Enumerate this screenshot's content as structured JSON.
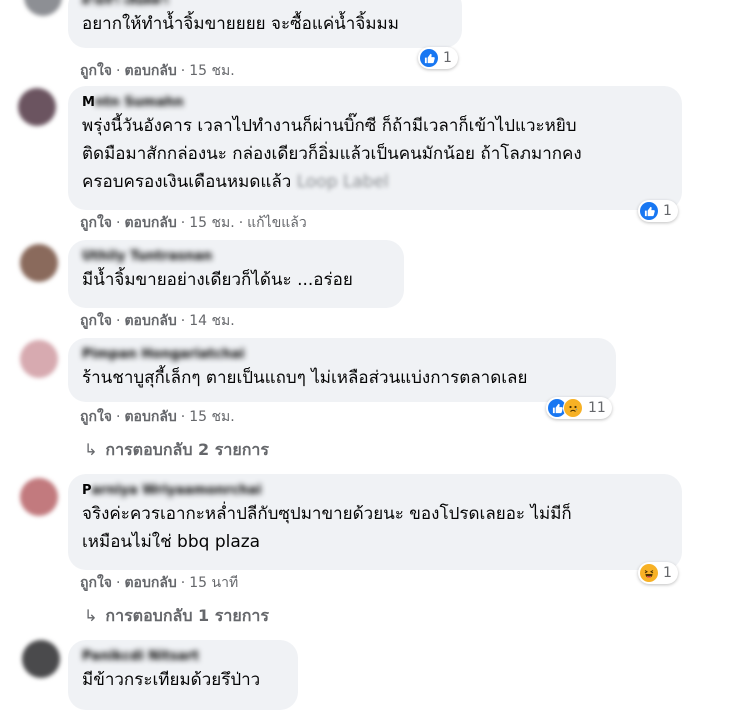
{
  "comments": [
    {
      "name": "ฝ่ายจำ เลือดดา",
      "text": "อยากให้ทำน้ำจิ้มขายยยย จะซื้อแค่น้ำจิ้มมม",
      "like": "ถูกใจ",
      "reply": "ตอบกลับ",
      "time": "15 ชม.",
      "reactions": {
        "count": "1",
        "icons": [
          "like-icon"
        ]
      }
    },
    {
      "name_first": "M",
      "name": "ntn Sumahn",
      "text": "พรุ่งนี้วันอังคาร เวลาไปทำงานก็ผ่านบิ๊กซี ก็ถ้ามีเวลาก็เข้าไปแวะหยิบ\nติดมือมาสักกล่องนะ กล่องเดียวก็อิ่มแล้วเป็นคนมักน้อย ถ้าโลภมากคง\nครอบครองเงินเดือนหมดแล้ว",
      "link_label": "Loop Label",
      "like": "ถูกใจ",
      "reply": "ตอบกลับ",
      "time": "15 ชม.",
      "edited": "แก้ไขแล้ว",
      "reactions": {
        "count": "1",
        "icons": [
          "like-icon"
        ]
      }
    },
    {
      "name": "Uthily Tuntrasnan",
      "text": "มีน้ำจิ้มขายอย่างเดียวก็ได้นะ ...อร่อย",
      "like": "ถูกใจ",
      "reply": "ตอบกลับ",
      "time": "14 ชม."
    },
    {
      "name": "Pimpan Hongariatchai",
      "text": "ร้านชาบูสุกี้เล็กๆ ตายเป็นแถบๆ ไม่เหลือส่วนแบ่งการตลาดเลย",
      "like": "ถูกใจ",
      "reply": "ตอบกลับ",
      "time": "15 ชม.",
      "reactions": {
        "count": "11",
        "icons": [
          "like-icon",
          "sad-icon"
        ]
      },
      "more_replies": "การตอบกลับ 2 รายการ"
    },
    {
      "name_first": "P",
      "name": "arniya Wriyaamonrchai",
      "text": "จริงค่ะควรเอากะหล่ำปลีกับซุปมาขายด้วยนะ ของโปรดเลยอะ ไม่มีก็\nเหมือนไม่ใช่ bbq plaza",
      "like": "ถูกใจ",
      "reply": "ตอบกลับ",
      "time": "15 นาที",
      "reactions": {
        "count": "1",
        "icons": [
          "haha-icon"
        ]
      },
      "more_replies": "การตอบกลับ 1 รายการ"
    },
    {
      "name": "Panikcdi Nitsart",
      "text": "มีข้าวกระเทียมด้วยรึป่าว"
    }
  ],
  "colors": {
    "bubble": "#f0f2f5",
    "meta": "#65676b",
    "like": "#1877f2",
    "haha": "#f7b125"
  }
}
